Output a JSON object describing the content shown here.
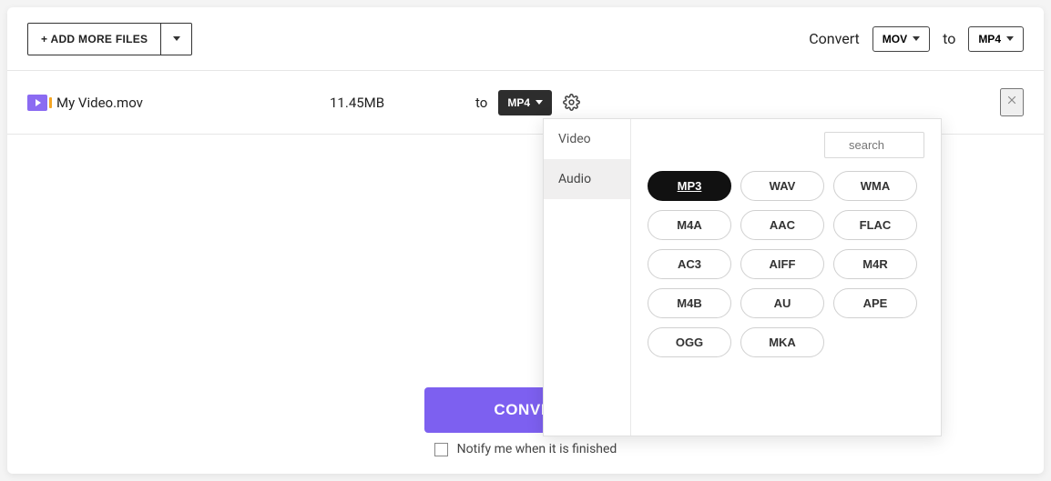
{
  "topbar": {
    "add_more_label": "+ ADD MORE FILES",
    "convert_label": "Convert",
    "to_label": "to",
    "source_format": "MOV",
    "target_format": "MP4"
  },
  "file_row": {
    "filename": "My Video.mov",
    "filesize": "11.45MB",
    "to_label": "to",
    "row_target_format": "MP4"
  },
  "dropdown": {
    "tabs": [
      "Video",
      "Audio"
    ],
    "active_tab_index": 1,
    "search_placeholder": "search",
    "formats": [
      "MP3",
      "WAV",
      "WMA",
      "M4A",
      "AAC",
      "FLAC",
      "AC3",
      "AIFF",
      "M4R",
      "M4B",
      "AU",
      "APE",
      "OGG",
      "MKA"
    ],
    "active_format": "MP3"
  },
  "footer": {
    "convert_button_label": "CONVERT",
    "notify_label": "Notify me when it is finished"
  }
}
